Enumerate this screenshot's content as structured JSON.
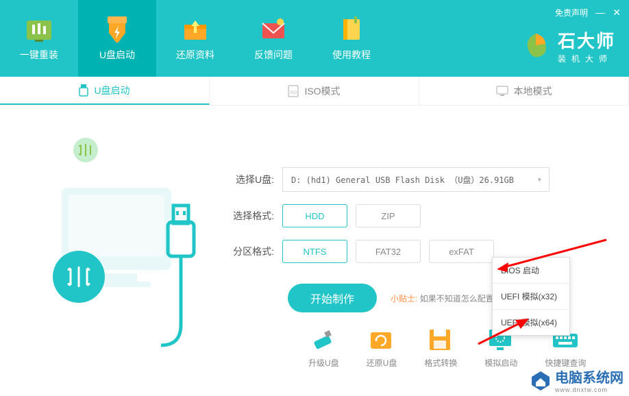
{
  "header": {
    "disclaimer": "免责声明",
    "nav": [
      {
        "label": "一键重装"
      },
      {
        "label": "U盘启动"
      },
      {
        "label": "还原资料"
      },
      {
        "label": "反馈问题"
      },
      {
        "label": "使用教程"
      }
    ],
    "logo_main": "石大师",
    "logo_sub": "装机大师"
  },
  "tabs": [
    {
      "label": "U盘启动"
    },
    {
      "label": "ISO模式"
    },
    {
      "label": "本地模式"
    }
  ],
  "form": {
    "udisk_label": "选择U盘:",
    "udisk_value": "D: (hd1) General USB Flash Disk （U盘）26.91GB",
    "mode_label": "选择格式:",
    "mode_options": [
      "HDD",
      "ZIP"
    ],
    "fs_label": "分区格式:",
    "fs_options": [
      "NTFS",
      "FAT32",
      "exFAT"
    ],
    "start_label": "开始制作",
    "tip_label": "小贴士:",
    "tip_text": "如果不知道怎么配置                       即可"
  },
  "bottom_icons": [
    "升级U盘",
    "还原U盘",
    "格式转换",
    "模拟启动",
    "快捷键查询"
  ],
  "popup": [
    "BIOS 启动",
    "UEFI 模拟(x32)",
    "UEFI 模拟(x64)"
  ],
  "watermark": {
    "text": "电脑系统网",
    "url": "www.dnxtw.com"
  }
}
